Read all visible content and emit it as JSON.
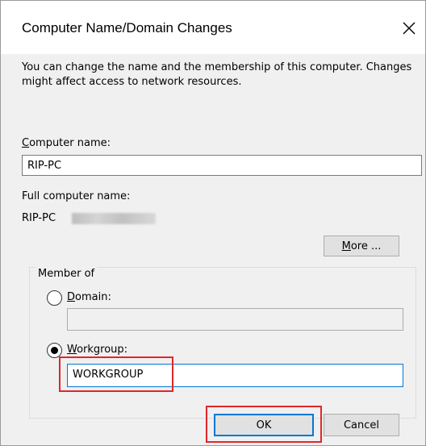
{
  "window": {
    "title": "Computer Name/Domain Changes",
    "close_icon": "close-icon"
  },
  "description": "You can change the name and the membership of this computer. Changes might affect access to network resources.",
  "computer_name": {
    "label_first": "C",
    "label_rest": "omputer name:",
    "value": "RIP-PC"
  },
  "full_computer_name": {
    "label": "Full computer name:",
    "value": "RIP-PC"
  },
  "more_button": {
    "label_first": "M",
    "label_rest": "ore ..."
  },
  "member_of": {
    "label": "Member of",
    "domain": {
      "label_first": "D",
      "label_rest": "omain:",
      "selected": false,
      "value": ""
    },
    "workgroup": {
      "label_first": "W",
      "label_rest": "orkgroup:",
      "selected": true,
      "value": "WORKGROUP"
    }
  },
  "buttons": {
    "ok": "OK",
    "cancel": "Cancel"
  },
  "colors": {
    "highlight": "#e0262b",
    "focus_border": "#0078d7",
    "dialog_bg": "#f0f0f0"
  }
}
